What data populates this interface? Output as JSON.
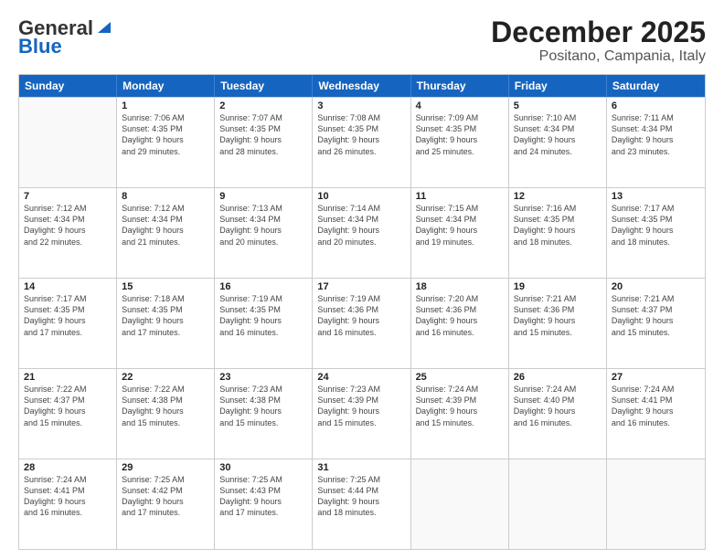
{
  "logo": {
    "general": "General",
    "blue": "Blue"
  },
  "header": {
    "month": "December 2025",
    "location": "Positano, Campania, Italy"
  },
  "weekdays": [
    "Sunday",
    "Monday",
    "Tuesday",
    "Wednesday",
    "Thursday",
    "Friday",
    "Saturday"
  ],
  "weeks": [
    [
      {
        "day": "",
        "sunrise": "",
        "sunset": "",
        "daylight": ""
      },
      {
        "day": "1",
        "sunrise": "Sunrise: 7:06 AM",
        "sunset": "Sunset: 4:35 PM",
        "daylight": "Daylight: 9 hours and 29 minutes."
      },
      {
        "day": "2",
        "sunrise": "Sunrise: 7:07 AM",
        "sunset": "Sunset: 4:35 PM",
        "daylight": "Daylight: 9 hours and 28 minutes."
      },
      {
        "day": "3",
        "sunrise": "Sunrise: 7:08 AM",
        "sunset": "Sunset: 4:35 PM",
        "daylight": "Daylight: 9 hours and 26 minutes."
      },
      {
        "day": "4",
        "sunrise": "Sunrise: 7:09 AM",
        "sunset": "Sunset: 4:35 PM",
        "daylight": "Daylight: 9 hours and 25 minutes."
      },
      {
        "day": "5",
        "sunrise": "Sunrise: 7:10 AM",
        "sunset": "Sunset: 4:34 PM",
        "daylight": "Daylight: 9 hours and 24 minutes."
      },
      {
        "day": "6",
        "sunrise": "Sunrise: 7:11 AM",
        "sunset": "Sunset: 4:34 PM",
        "daylight": "Daylight: 9 hours and 23 minutes."
      }
    ],
    [
      {
        "day": "7",
        "sunrise": "Sunrise: 7:12 AM",
        "sunset": "Sunset: 4:34 PM",
        "daylight": "Daylight: 9 hours and 22 minutes."
      },
      {
        "day": "8",
        "sunrise": "Sunrise: 7:12 AM",
        "sunset": "Sunset: 4:34 PM",
        "daylight": "Daylight: 9 hours and 21 minutes."
      },
      {
        "day": "9",
        "sunrise": "Sunrise: 7:13 AM",
        "sunset": "Sunset: 4:34 PM",
        "daylight": "Daylight: 9 hours and 20 minutes."
      },
      {
        "day": "10",
        "sunrise": "Sunrise: 7:14 AM",
        "sunset": "Sunset: 4:34 PM",
        "daylight": "Daylight: 9 hours and 20 minutes."
      },
      {
        "day": "11",
        "sunrise": "Sunrise: 7:15 AM",
        "sunset": "Sunset: 4:34 PM",
        "daylight": "Daylight: 9 hours and 19 minutes."
      },
      {
        "day": "12",
        "sunrise": "Sunrise: 7:16 AM",
        "sunset": "Sunset: 4:35 PM",
        "daylight": "Daylight: 9 hours and 18 minutes."
      },
      {
        "day": "13",
        "sunrise": "Sunrise: 7:17 AM",
        "sunset": "Sunset: 4:35 PM",
        "daylight": "Daylight: 9 hours and 18 minutes."
      }
    ],
    [
      {
        "day": "14",
        "sunrise": "Sunrise: 7:17 AM",
        "sunset": "Sunset: 4:35 PM",
        "daylight": "Daylight: 9 hours and 17 minutes."
      },
      {
        "day": "15",
        "sunrise": "Sunrise: 7:18 AM",
        "sunset": "Sunset: 4:35 PM",
        "daylight": "Daylight: 9 hours and 17 minutes."
      },
      {
        "day": "16",
        "sunrise": "Sunrise: 7:19 AM",
        "sunset": "Sunset: 4:35 PM",
        "daylight": "Daylight: 9 hours and 16 minutes."
      },
      {
        "day": "17",
        "sunrise": "Sunrise: 7:19 AM",
        "sunset": "Sunset: 4:36 PM",
        "daylight": "Daylight: 9 hours and 16 minutes."
      },
      {
        "day": "18",
        "sunrise": "Sunrise: 7:20 AM",
        "sunset": "Sunset: 4:36 PM",
        "daylight": "Daylight: 9 hours and 16 minutes."
      },
      {
        "day": "19",
        "sunrise": "Sunrise: 7:21 AM",
        "sunset": "Sunset: 4:36 PM",
        "daylight": "Daylight: 9 hours and 15 minutes."
      },
      {
        "day": "20",
        "sunrise": "Sunrise: 7:21 AM",
        "sunset": "Sunset: 4:37 PM",
        "daylight": "Daylight: 9 hours and 15 minutes."
      }
    ],
    [
      {
        "day": "21",
        "sunrise": "Sunrise: 7:22 AM",
        "sunset": "Sunset: 4:37 PM",
        "daylight": "Daylight: 9 hours and 15 minutes."
      },
      {
        "day": "22",
        "sunrise": "Sunrise: 7:22 AM",
        "sunset": "Sunset: 4:38 PM",
        "daylight": "Daylight: 9 hours and 15 minutes."
      },
      {
        "day": "23",
        "sunrise": "Sunrise: 7:23 AM",
        "sunset": "Sunset: 4:38 PM",
        "daylight": "Daylight: 9 hours and 15 minutes."
      },
      {
        "day": "24",
        "sunrise": "Sunrise: 7:23 AM",
        "sunset": "Sunset: 4:39 PM",
        "daylight": "Daylight: 9 hours and 15 minutes."
      },
      {
        "day": "25",
        "sunrise": "Sunrise: 7:24 AM",
        "sunset": "Sunset: 4:39 PM",
        "daylight": "Daylight: 9 hours and 15 minutes."
      },
      {
        "day": "26",
        "sunrise": "Sunrise: 7:24 AM",
        "sunset": "Sunset: 4:40 PM",
        "daylight": "Daylight: 9 hours and 16 minutes."
      },
      {
        "day": "27",
        "sunrise": "Sunrise: 7:24 AM",
        "sunset": "Sunset: 4:41 PM",
        "daylight": "Daylight: 9 hours and 16 minutes."
      }
    ],
    [
      {
        "day": "28",
        "sunrise": "Sunrise: 7:24 AM",
        "sunset": "Sunset: 4:41 PM",
        "daylight": "Daylight: 9 hours and 16 minutes."
      },
      {
        "day": "29",
        "sunrise": "Sunrise: 7:25 AM",
        "sunset": "Sunset: 4:42 PM",
        "daylight": "Daylight: 9 hours and 17 minutes."
      },
      {
        "day": "30",
        "sunrise": "Sunrise: 7:25 AM",
        "sunset": "Sunset: 4:43 PM",
        "daylight": "Daylight: 9 hours and 17 minutes."
      },
      {
        "day": "31",
        "sunrise": "Sunrise: 7:25 AM",
        "sunset": "Sunset: 4:44 PM",
        "daylight": "Daylight: 9 hours and 18 minutes."
      },
      {
        "day": "",
        "sunrise": "",
        "sunset": "",
        "daylight": ""
      },
      {
        "day": "",
        "sunrise": "",
        "sunset": "",
        "daylight": ""
      },
      {
        "day": "",
        "sunrise": "",
        "sunset": "",
        "daylight": ""
      }
    ]
  ]
}
